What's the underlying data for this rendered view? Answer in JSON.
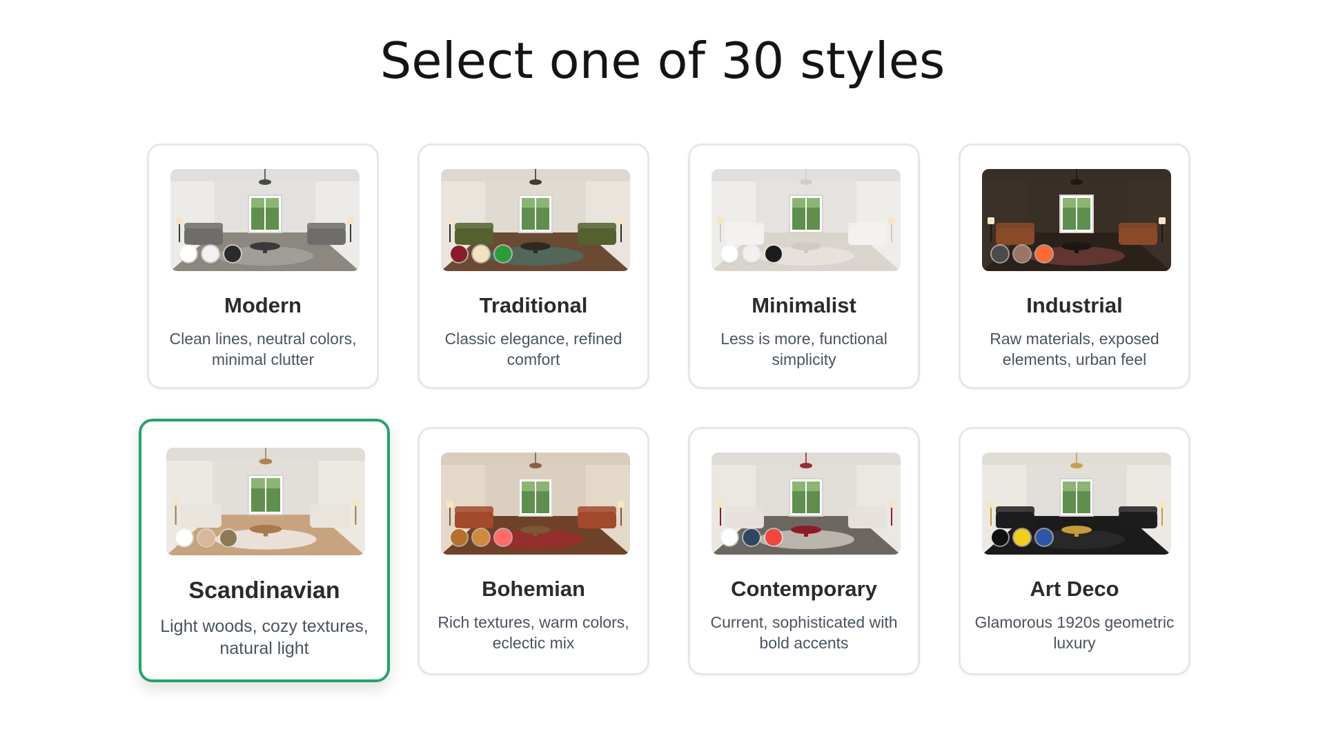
{
  "page": {
    "title": "Select one of 30 styles"
  },
  "colors": {
    "selected_border": "#23a36c",
    "card_border": "#e6e6e6",
    "title_text": "#141414",
    "card_title_text": "#2b2b2b",
    "card_desc_text": "#4a5360"
  },
  "styles": [
    {
      "name": "Modern",
      "description": "Clean lines, neutral colors, minimal clutter",
      "selected": false,
      "swatches": [
        "#ffffff",
        "#f1f1f1",
        "#2b2b2b"
      ],
      "room": {
        "wall": "#ecebe8",
        "floor": "#8c877f",
        "sofa": "#6f6d6a",
        "accent": "#3a3a3a",
        "rug": "#a5a29c"
      }
    },
    {
      "name": "Traditional",
      "description": "Classic elegance, refined comfort",
      "selected": false,
      "swatches": [
        "#8b1a2b",
        "#f3e2c0",
        "#2a9d3a"
      ],
      "room": {
        "wall": "#e9e4dc",
        "floor": "#6b4a33",
        "sofa": "#55602f",
        "accent": "#2e2a22",
        "rug": "#4f6b62"
      }
    },
    {
      "name": "Minimalist",
      "description": "Less is more, functional simplicity",
      "selected": false,
      "swatches": [
        "#ffffff",
        "#f1f1f1",
        "#1c1c1c"
      ],
      "room": {
        "wall": "#efedea",
        "floor": "#d9d4cc",
        "sofa": "#f4f2ee",
        "accent": "#cfcac2",
        "rug": "#e7e3dc"
      }
    },
    {
      "name": "Industrial",
      "description": "Raw materials, exposed elements, urban feel",
      "selected": false,
      "swatches": [
        "#4b4b4b",
        "#9b7466",
        "#ff6a33"
      ],
      "room": {
        "wall": "#3b3129",
        "floor": "#2a211b",
        "sofa": "#8a4a28",
        "accent": "#1c1714",
        "rug": "#6b3a33"
      }
    },
    {
      "name": "Scandinavian",
      "description": "Light woods, cozy textures, natural light",
      "selected": true,
      "swatches": [
        "#ffffff",
        "#d8b89a",
        "#8a7a55"
      ],
      "room": {
        "wall": "#ece9e3",
        "floor": "#c8a47e",
        "sofa": "#e9e4dc",
        "accent": "#a77a4c",
        "rug": "#efece6"
      }
    },
    {
      "name": "Bohemian",
      "description": "Rich textures, warm colors, eclectic mix",
      "selected": false,
      "swatches": [
        "#b5702a",
        "#d08a3a",
        "#ff6b6b"
      ],
      "room": {
        "wall": "#e4d8c8",
        "floor": "#6e4129",
        "sofa": "#a3492c",
        "accent": "#7d5634",
        "rug": "#9a2d2d"
      }
    },
    {
      "name": "Contemporary",
      "description": "Current, sophisticated with bold accents",
      "selected": false,
      "swatches": [
        "#ffffff",
        "#2e4760",
        "#f0463c"
      ],
      "room": {
        "wall": "#ebe8e3",
        "floor": "#6c6661",
        "sofa": "#e6e1da",
        "accent": "#8e1a25",
        "rug": "#c8c3bb"
      }
    },
    {
      "name": "Art Deco",
      "description": "Glamorous 1920s geometric luxury",
      "selected": false,
      "swatches": [
        "#111111",
        "#f2cf1d",
        "#2d56a6"
      ],
      "room": {
        "wall": "#ece8e2",
        "floor": "#1b1b1b",
        "sofa": "#1d1d1d",
        "accent": "#c89a3a",
        "rug": "#2a2a2a"
      }
    }
  ]
}
